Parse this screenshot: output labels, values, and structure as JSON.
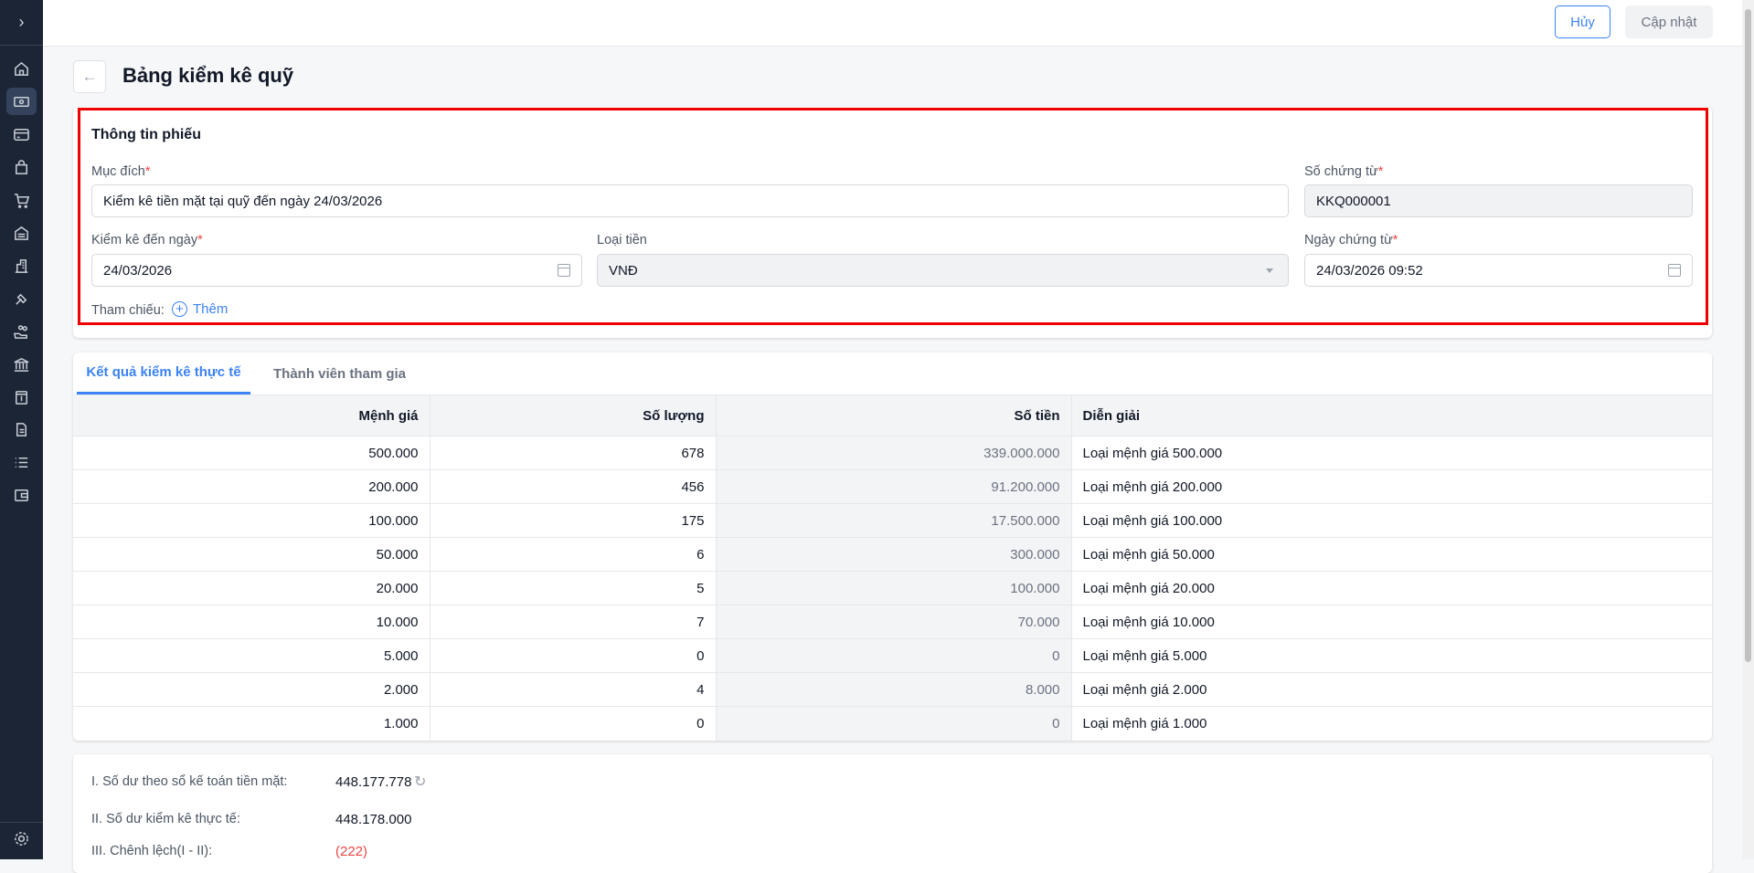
{
  "header": {
    "cancel_label": "Hủy",
    "update_label": "Cập nhật"
  },
  "page": {
    "title": "Bảng kiểm kê quỹ"
  },
  "form": {
    "section_title": "Thông tin phiếu",
    "purpose": {
      "label": "Mục đích",
      "value": "Kiểm kê tiền mặt tại quỹ đến ngày 24/03/2026"
    },
    "voucher_no": {
      "label": "Số chứng từ",
      "value": "KKQ000001"
    },
    "count_date": {
      "label": "Kiểm kê đến ngày",
      "value": "24/03/2026"
    },
    "currency": {
      "label": "Loại tiền",
      "value": "VNĐ"
    },
    "voucher_date": {
      "label": "Ngày chứng từ",
      "value": "24/03/2026 09:52"
    },
    "reference": {
      "label": "Tham chiếu:",
      "add_label": "Thêm"
    },
    "required_mark": "*"
  },
  "tabs": [
    {
      "label": "Kết quả kiểm kê thực tế",
      "active": true
    },
    {
      "label": "Thành viên tham gia",
      "active": false
    }
  ],
  "table": {
    "columns": [
      "Mệnh giá",
      "Số lượng",
      "Số tiền",
      "Diễn giải"
    ],
    "rows": [
      [
        "500.000",
        "678",
        "339.000.000",
        "Loại mệnh giá 500.000"
      ],
      [
        "200.000",
        "456",
        "91.200.000",
        "Loại mệnh giá 200.000"
      ],
      [
        "100.000",
        "175",
        "17.500.000",
        "Loại mệnh giá 100.000"
      ],
      [
        "50.000",
        "6",
        "300.000",
        "Loại mệnh giá 50.000"
      ],
      [
        "20.000",
        "5",
        "100.000",
        "Loại mệnh giá 20.000"
      ],
      [
        "10.000",
        "7",
        "70.000",
        "Loại mệnh giá 10.000"
      ],
      [
        "5.000",
        "0",
        "0",
        "Loại mệnh giá 5.000"
      ],
      [
        "2.000",
        "4",
        "8.000",
        "Loại mệnh giá 2.000"
      ],
      [
        "1.000",
        "0",
        "0",
        "Loại mệnh giá 1.000"
      ]
    ]
  },
  "summary": {
    "book_balance": {
      "label": "I. Số dư theo sổ kế toán tiền mặt:",
      "value": "448.177.778"
    },
    "actual_balance": {
      "label": "II. Số dư kiểm kê thực tế:",
      "value": "448.178.000"
    },
    "difference": {
      "label": "III. Chênh lệch(I - II):",
      "value": "(222)"
    }
  },
  "colors": {
    "accent": "#3b82f6",
    "sidebar": "#1c2536",
    "negative": "#ef4444",
    "highlight": "#ee0000"
  }
}
